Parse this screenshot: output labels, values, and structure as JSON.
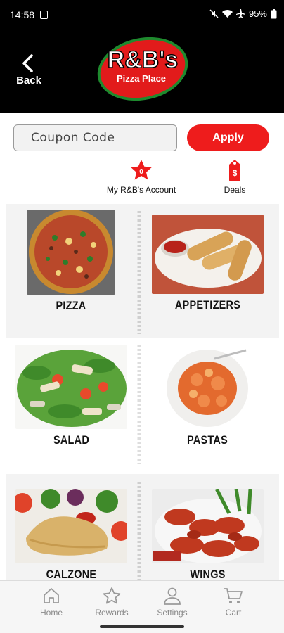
{
  "status": {
    "time": "14:58",
    "battery": "95%"
  },
  "header": {
    "back_label": "Back",
    "logo_title": "R&B's",
    "logo_subtitle": "Pizza Place"
  },
  "coupon": {
    "placeholder": "Coupon Code",
    "apply_label": "Apply"
  },
  "quick_links": {
    "account": {
      "label": "My R&B's Account",
      "badge": "0"
    },
    "deals": {
      "label": "Deals",
      "badge": "$"
    }
  },
  "menu": {
    "items": [
      {
        "label": "PIZZA"
      },
      {
        "label": "APPETIZERS"
      },
      {
        "label": "SALAD"
      },
      {
        "label": "PASTAS"
      },
      {
        "label": "CALZONE"
      },
      {
        "label": "WINGS"
      }
    ]
  },
  "nav": {
    "items": [
      {
        "label": "Home"
      },
      {
        "label": "Rewards"
      },
      {
        "label": "Settings"
      },
      {
        "label": "Cart"
      }
    ]
  },
  "colors": {
    "accent": "#ee1c1c",
    "header_bg": "#000000",
    "nav_text": "#8a8a8a"
  }
}
